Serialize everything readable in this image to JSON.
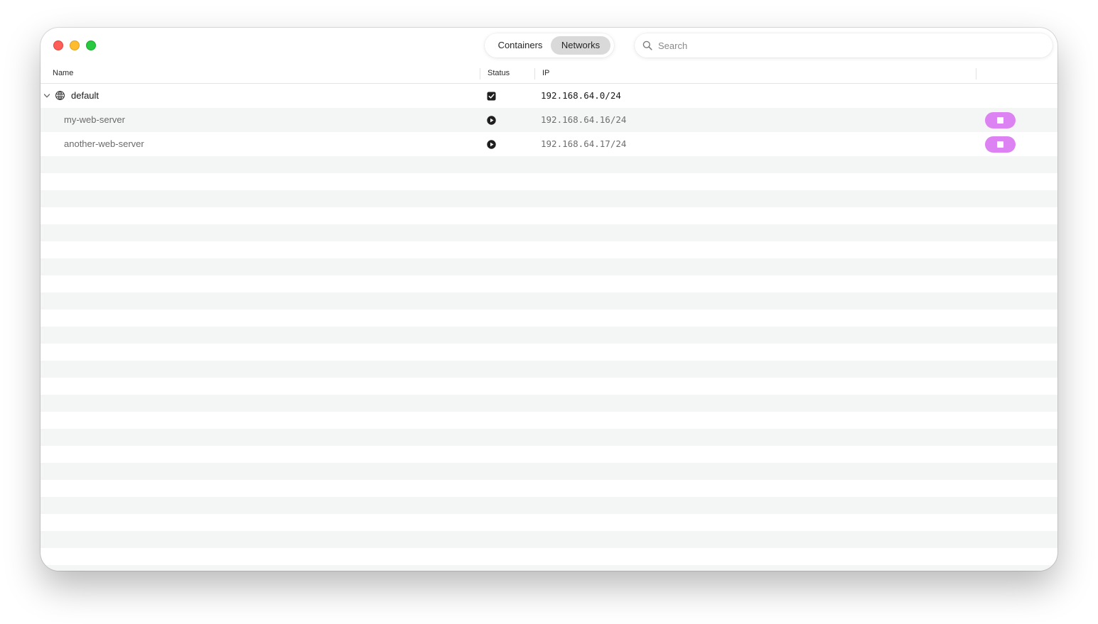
{
  "colors": {
    "accent": "#dd82f2",
    "traffic_close": "#ff5f57",
    "traffic_minimize": "#febc2e",
    "traffic_maximize": "#28c840",
    "row_stripe": "#f4f5f5"
  },
  "toolbar": {
    "segments": [
      {
        "label": "Containers",
        "selected": false
      },
      {
        "label": "Networks",
        "selected": true
      }
    ],
    "search": {
      "placeholder": "Search",
      "value": "",
      "icon": "magnifying-glass-icon"
    }
  },
  "table": {
    "columns": [
      {
        "label": "Name"
      },
      {
        "label": "Status"
      },
      {
        "label": "IP"
      },
      {
        "label": ""
      }
    ],
    "rows": [
      {
        "name": "default",
        "status": "checked",
        "status_icon": "checkbox-checked-icon",
        "ip": "192.168.64.0/24",
        "icon": "globe-icon",
        "expanded": true,
        "level": 0
      },
      {
        "name": "my-web-server",
        "status": "running",
        "status_icon": "play-circle-icon",
        "ip": "192.168.64.16/24",
        "action_icon": "stop-icon",
        "level": 1
      },
      {
        "name": "another-web-server",
        "status": "running",
        "status_icon": "play-circle-icon",
        "ip": "192.168.64.17/24",
        "action_icon": "stop-icon",
        "level": 1
      }
    ]
  }
}
